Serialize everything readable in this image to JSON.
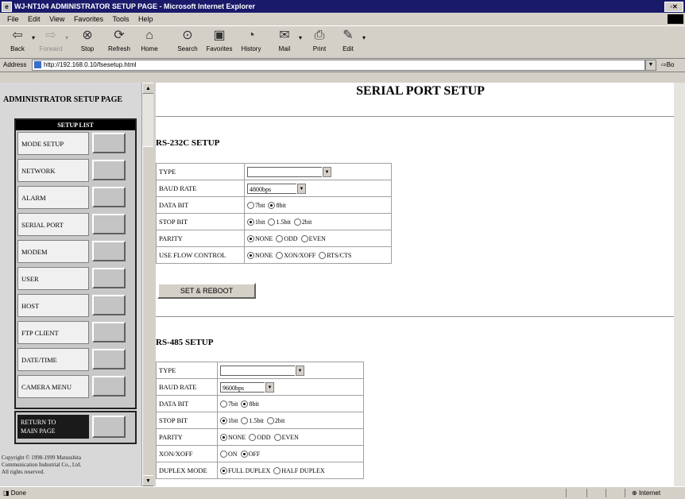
{
  "window": {
    "title": "WJ-NT104 ADMINISTRATOR SETUP PAGE - Microsoft Internet Explorer"
  },
  "menu": [
    "File",
    "Edit",
    "View",
    "Favorites",
    "Tools",
    "Help"
  ],
  "toolbar": {
    "back": "Back",
    "forward": "Forward",
    "stop": "Stop",
    "refresh": "Refresh",
    "home": "Home",
    "search": "Search",
    "favorites": "Favorites",
    "history": "History",
    "mail": "Mail",
    "print": "Print",
    "edit": "Edit"
  },
  "address": {
    "label": "Address",
    "url": "http://192.168.0.10/fsesetup.html",
    "go": "Bo"
  },
  "left": {
    "title": "ADMINISTRATOR SETUP PAGE",
    "setup_list_header": "SETUP LIST",
    "items": [
      "MODE SETUP",
      "NETWORK",
      "ALARM",
      "SERIAL PORT",
      "MODEM",
      "USER",
      "HOST",
      "FTP CLIENT",
      "DATE/TIME",
      "CAMERA MENU"
    ],
    "return_label_1": "RETURN TO",
    "return_label_2": "MAIN PAGE",
    "copyright_1": "Copyright © 1998-1999 Matsushita",
    "copyright_2": "Communication Industrial Co., Ltd.",
    "copyright_3": "All rights reserved."
  },
  "main": {
    "page_title": "SERIAL PORT SETUP",
    "rs232": {
      "heading": "RS-232C SETUP",
      "type_label": "TYPE",
      "type_value": "",
      "baud_label": "BAUD RATE",
      "baud_value": "4800bps",
      "databit_label": "DATA BIT",
      "databit_opt1": "7bit",
      "databit_opt2": "8bit",
      "stopbit_label": "STOP BIT",
      "stopbit_opt1": "1bit",
      "stopbit_opt2": "1.5bit",
      "stopbit_opt3": "2bit",
      "parity_label": "PARITY",
      "parity_opt1": "NONE",
      "parity_opt2": "ODD",
      "parity_opt3": "EVEN",
      "flow_label": "USE FLOW CONTROL",
      "flow_opt1": "NONE",
      "flow_opt2": "XON/XOFF",
      "flow_opt3": "RTS/CTS",
      "set_button": "SET & REBOOT"
    },
    "rs485": {
      "heading": "RS-485 SETUP",
      "type_label": "TYPE",
      "type_value": "",
      "baud_label": "BAUD RATE",
      "baud_value": "9600bps",
      "databit_label": "DATA BIT",
      "databit_opt1": "7bit",
      "databit_opt2": "8bit",
      "stopbit_label": "STOP BIT",
      "stopbit_opt1": "1bit",
      "stopbit_opt2": "1.5bit",
      "stopbit_opt3": "2bit",
      "parity_label": "PARITY",
      "parity_opt1": "NONE",
      "parity_opt2": "ODD",
      "parity_opt3": "EVEN",
      "xon_label": "XON/XOFF",
      "xon_opt1": "ON",
      "xon_opt2": "OFF",
      "duplex_label": "DUPLEX MODE",
      "duplex_opt1": "FULL DUPLEX",
      "duplex_opt2": "HALF DUPLEX"
    }
  },
  "status": {
    "left": "Done",
    "zone": "Internet"
  }
}
